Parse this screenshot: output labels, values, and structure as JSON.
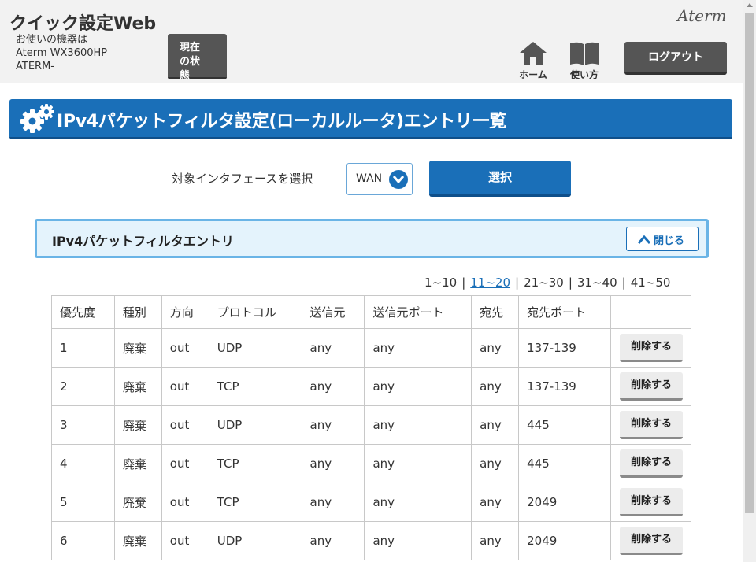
{
  "header": {
    "app_title": "クイック設定Web",
    "device_label": "お使いの機器は",
    "device_model": "Aterm WX3600HP",
    "device_name": "ATERM-",
    "status_button": "現在の状態",
    "brand": "Aterm",
    "home_label": "ホーム",
    "help_label": "使い方",
    "logout_button": "ログアウト"
  },
  "page": {
    "title": "IPv4パケットフィルタ設定(ローカルルータ)エントリ一覧"
  },
  "interface": {
    "label": "対象インタフェースを選択",
    "selected": "WAN",
    "submit_button": "選択"
  },
  "panel": {
    "title": "IPv4パケットフィルタエントリ",
    "close_button": "閉じる"
  },
  "pagination": {
    "pages": [
      "1~10",
      "11~20",
      "21~30",
      "31~40",
      "41~50"
    ],
    "active_index": 1
  },
  "table": {
    "columns": [
      "優先度",
      "種別",
      "方向",
      "プロトコル",
      "送信元",
      "送信元ポート",
      "宛先",
      "宛先ポート",
      ""
    ],
    "delete_label": "削除する",
    "rows": [
      [
        "1",
        "廃棄",
        "out",
        "UDP",
        "any",
        "any",
        "any",
        "137-139"
      ],
      [
        "2",
        "廃棄",
        "out",
        "TCP",
        "any",
        "any",
        "any",
        "137-139"
      ],
      [
        "3",
        "廃棄",
        "out",
        "UDP",
        "any",
        "any",
        "any",
        "445"
      ],
      [
        "4",
        "廃棄",
        "out",
        "TCP",
        "any",
        "any",
        "any",
        "445"
      ],
      [
        "5",
        "廃棄",
        "out",
        "TCP",
        "any",
        "any",
        "any",
        "2049"
      ],
      [
        "6",
        "廃棄",
        "out",
        "UDP",
        "any",
        "any",
        "any",
        "2049"
      ]
    ]
  },
  "colors": {
    "accent": "#1a6fb8",
    "panel_bg": "#e4f3fc",
    "panel_border": "#6ab4e6",
    "dark_button": "#555555"
  },
  "icons": {
    "gear": "gear-icon",
    "home": "home-icon",
    "help": "book-icon",
    "chevron_down": "chevron-down-icon",
    "chevron_up": "chevron-up-icon"
  }
}
